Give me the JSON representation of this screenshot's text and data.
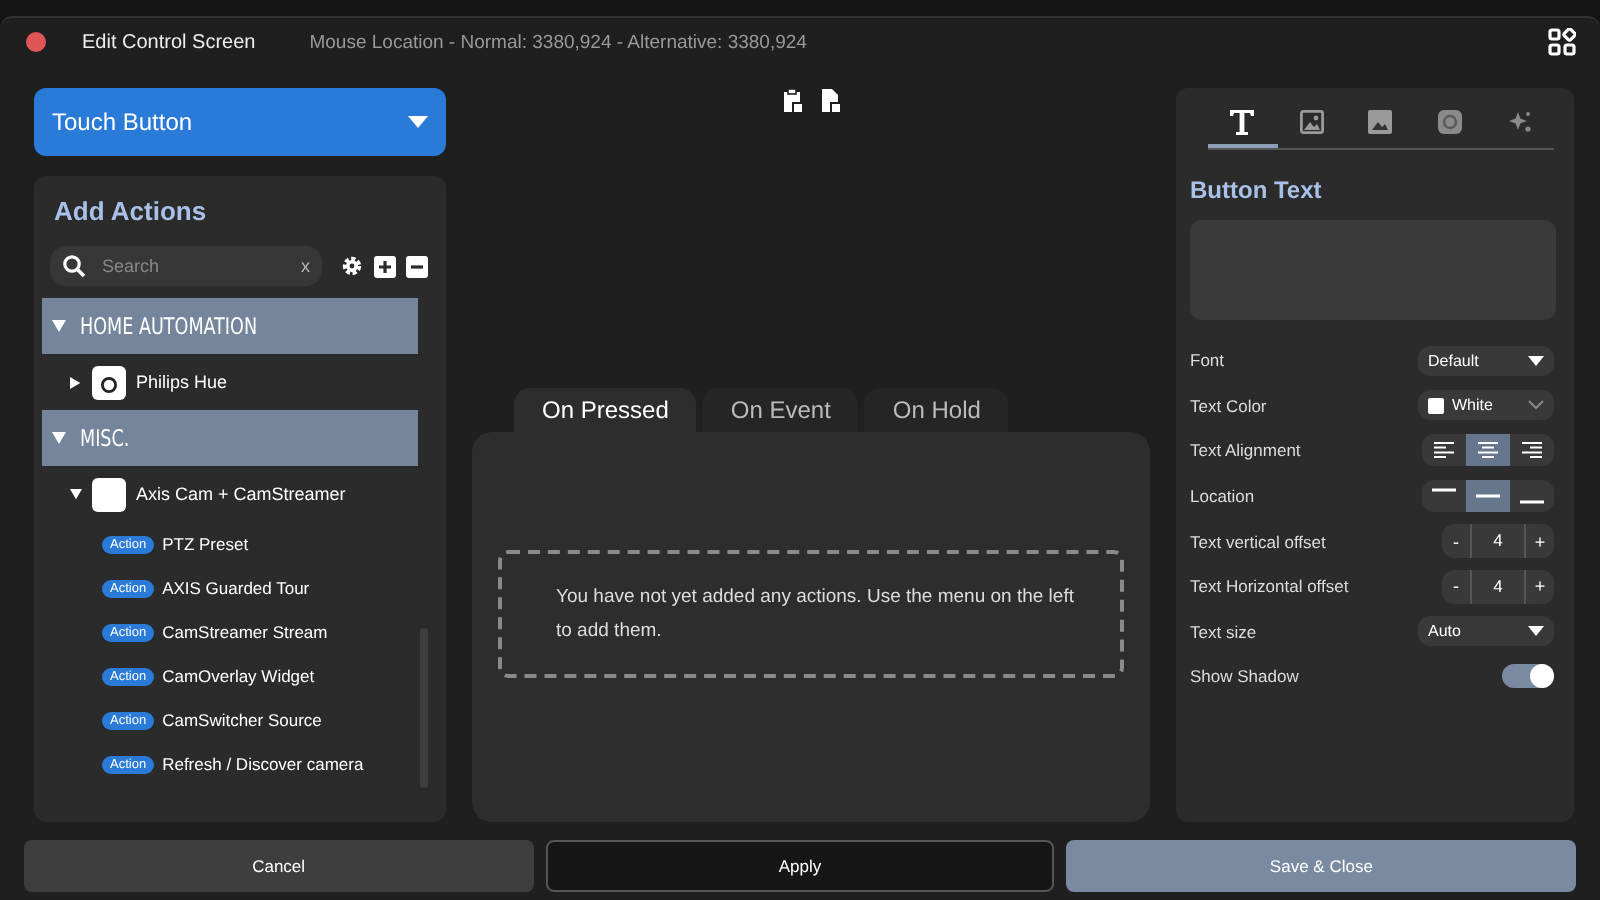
{
  "window": {
    "title": "Edit Control Screen",
    "mouse_location": "Mouse Location - Normal: 3380,924 - Alternative: 3380,924"
  },
  "button_type": {
    "value": "Touch Button"
  },
  "actions_panel": {
    "title": "Add Actions",
    "search": {
      "placeholder": "Search",
      "clear": "x"
    },
    "tree": [
      {
        "kind": "category",
        "label": "HOME AUTOMATION",
        "expanded": true,
        "children": [
          {
            "kind": "plugin",
            "label": "Philips Hue",
            "expanded": false
          }
        ]
      },
      {
        "kind": "category",
        "label": "MISC.",
        "expanded": true,
        "children": [
          {
            "kind": "plugin",
            "label": "Axis Cam + CamStreamer",
            "expanded": true,
            "children": [
              {
                "kind": "action",
                "badge": "Action",
                "label": "PTZ Preset"
              },
              {
                "kind": "action",
                "badge": "Action",
                "label": "AXIS Guarded Tour"
              },
              {
                "kind": "action",
                "badge": "Action",
                "label": "CamStreamer Stream"
              },
              {
                "kind": "action",
                "badge": "Action",
                "label": "CamOverlay Widget"
              },
              {
                "kind": "action",
                "badge": "Action",
                "label": "CamSwitcher Source"
              },
              {
                "kind": "action",
                "badge": "Action",
                "label": "Refresh / Discover camera"
              }
            ]
          }
        ]
      }
    ]
  },
  "event_tabs": [
    {
      "label": "On Pressed",
      "selected": true
    },
    {
      "label": "On Event",
      "selected": false
    },
    {
      "label": "On Hold",
      "selected": false
    }
  ],
  "empty_message": "You have not yet added any actions. Use the menu on the left to add them.",
  "properties": {
    "tabs": [
      {
        "kind": "text",
        "selected": true
      },
      {
        "kind": "image",
        "selected": false
      },
      {
        "kind": "background",
        "selected": false
      },
      {
        "kind": "icon",
        "selected": false
      },
      {
        "kind": "effects",
        "selected": false
      }
    ],
    "section_title": "Button Text",
    "rows": [
      {
        "kind": "select",
        "label": "Font",
        "value": "Default"
      },
      {
        "kind": "color",
        "label": "Text Color",
        "value": "White",
        "color": "#ffffff"
      },
      {
        "kind": "segmented",
        "label": "Text Alignment",
        "options": [
          {
            "kind": "left",
            "selected": false
          },
          {
            "kind": "center",
            "selected": true
          },
          {
            "kind": "right",
            "selected": false
          }
        ]
      },
      {
        "kind": "segmented",
        "label": "Location",
        "options": [
          {
            "kind": "top",
            "selected": false
          },
          {
            "kind": "middle",
            "selected": true
          },
          {
            "kind": "bottom",
            "selected": false
          }
        ]
      },
      {
        "kind": "stepper",
        "label": "Text vertical offset",
        "value": "4",
        "minus": "-",
        "plus": "+"
      },
      {
        "kind": "stepper",
        "label": "Text Horizontal offset",
        "value": "4",
        "minus": "-",
        "plus": "+"
      },
      {
        "kind": "select",
        "label": "Text size",
        "value": "Auto"
      },
      {
        "kind": "toggle",
        "label": "Show Shadow",
        "on": true
      }
    ]
  },
  "footer_buttons": [
    {
      "kind": "secondary",
      "label": "Cancel"
    },
    {
      "kind": "outline",
      "label": "Apply"
    },
    {
      "kind": "primary",
      "label": "Save & Close"
    }
  ]
}
